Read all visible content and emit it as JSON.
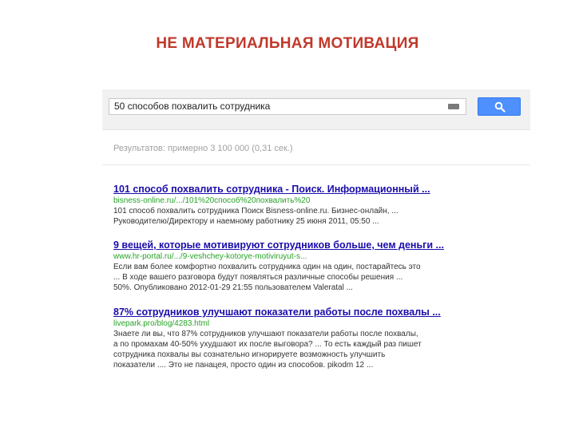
{
  "slide": {
    "title": "НЕ МАТЕРИАЛЬНАЯ МОТИВАЦИЯ"
  },
  "search": {
    "query": "50 способов похвалить сотрудника",
    "stats": "Результатов: примерно 3 100 000 (0,31 сек.)"
  },
  "colors": {
    "title": "#c0392b",
    "link": "#1a0dab",
    "url": "#27a327",
    "button": "#4d90fe"
  },
  "results": [
    {
      "title": "101 способ похвалить сотрудника - Поиск. Информационный ...",
      "url": "bisness-online.ru/.../101%20способ%20похвалить%20",
      "snippet": [
        "101 способ похвалить сотрудника Поиск Bisness-online.ru. Бизнес-онлайн, ...",
        "Руководителю/Директору и наемному работнику 25 июня 2011, 05:50 ..."
      ]
    },
    {
      "title": "9 вещей, которые мотивируют сотрудников больше, чем деньги ...",
      "url": "www.hr-portal.ru/.../9-veshchey-kotorye-motiviruyut-s...",
      "snippet": [
        "Если вам более комфортно похвалить сотрудника один на один, постарайтесь это",
        "... В ходе вашего разговора будут появляться различные способы решения ...",
        "50%. Опубликовано 2012-01-29 21:55 пользователем Valeratal ..."
      ]
    },
    {
      "title": "87% сотрудников улучшают показатели работы после похвалы ...",
      "url": "livepark.pro/blog/4283.html",
      "snippet": [
        "Знаете ли вы, что 87% сотрудников улучшают показатели работы после похвалы,",
        "а по промахам 40-50% ухудшают их после выговора? ... То есть каждый раз пишет",
        "сотрудника похвалы вы сознательно игнорируете возможность улучшить",
        "показатели .... Это не панацея, просто один из способов. pikodm 12 ..."
      ]
    }
  ]
}
